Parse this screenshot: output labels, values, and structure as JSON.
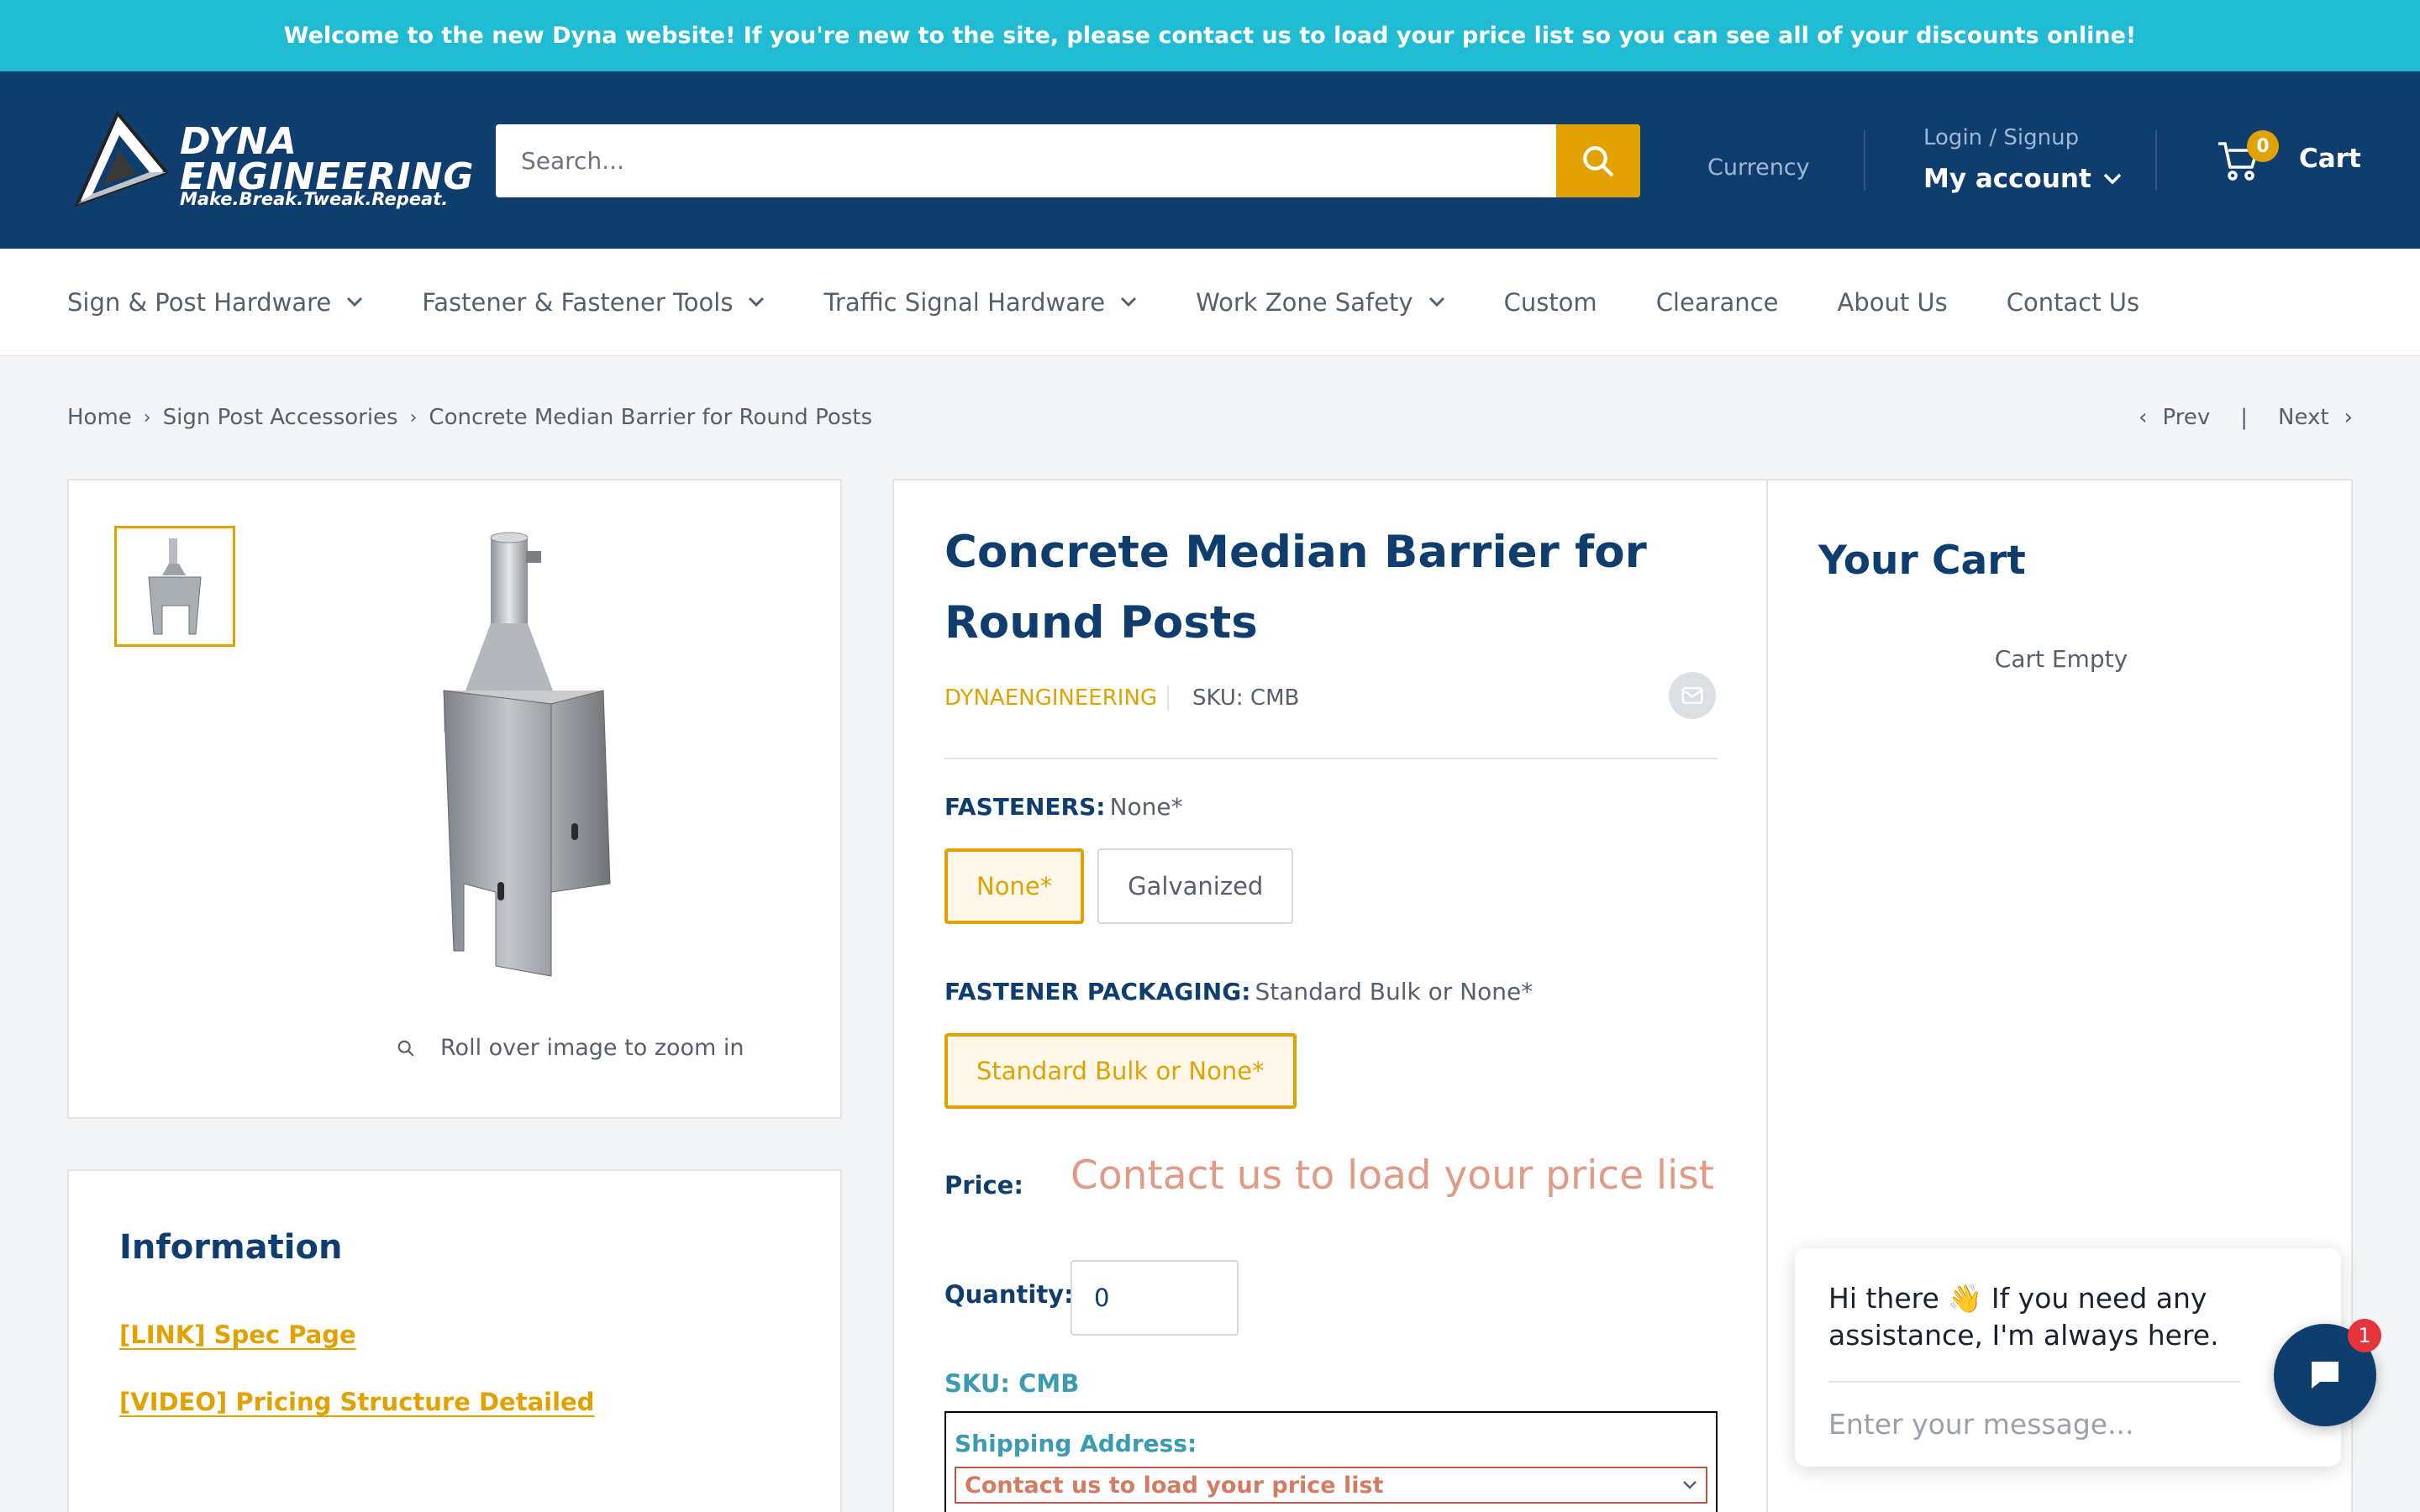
{
  "announcement": "Welcome to the new Dyna website! If you're new to the site, please contact us to load your price list so you can see all of your discounts online!",
  "header": {
    "logo_line1": "DYNA",
    "logo_line2": "ENGINEERING",
    "logo_tagline": "Make.Break.Tweak.Repeat.",
    "search_placeholder": "Search...",
    "currency": "Currency",
    "login": "Login / Signup",
    "my_account": "My account",
    "cart_count": "0",
    "cart_label": "Cart"
  },
  "nav": {
    "items": [
      {
        "label": "Sign & Post Hardware",
        "dropdown": true
      },
      {
        "label": "Fastener & Fastener Tools",
        "dropdown": true
      },
      {
        "label": "Traffic Signal Hardware",
        "dropdown": true
      },
      {
        "label": "Work Zone Safety",
        "dropdown": true
      },
      {
        "label": "Custom",
        "dropdown": false
      },
      {
        "label": "Clearance",
        "dropdown": false
      },
      {
        "label": "About Us",
        "dropdown": false
      },
      {
        "label": "Contact Us",
        "dropdown": false
      }
    ]
  },
  "breadcrumb": {
    "home": "Home",
    "category": "Sign Post Accessories",
    "current": "Concrete Median Barrier for Round Posts",
    "prev": "Prev",
    "separator": "|",
    "next": "Next"
  },
  "gallery": {
    "zoom_hint": "Roll over image to zoom in"
  },
  "information": {
    "title": "Information",
    "link1": "[LINK] Spec Page",
    "link2": "[VIDEO] Pricing Structure Detailed"
  },
  "product": {
    "title": "Concrete Median Barrier for Round Posts",
    "vendor": "DYNAENGINEERING",
    "sku": "SKU: CMB",
    "fasteners_label": "FASTENERS:",
    "fasteners_value": "None*",
    "fasteners_options": [
      "None*",
      "Galvanized"
    ],
    "packaging_label": "FASTENER PACKAGING:",
    "packaging_value": "Standard Bulk or None*",
    "packaging_options": [
      "Standard Bulk or None*"
    ],
    "price_label": "Price:",
    "price_value": "Contact us to load your price list",
    "quantity_label": "Quantity:",
    "quantity_value": "0",
    "sku_repeat": "SKU: CMB",
    "shipping_label": "Shipping Address:",
    "shipping_select": "Contact us to load your price list"
  },
  "cart_panel": {
    "title": "Your Cart",
    "empty": "Cart Empty"
  },
  "chat": {
    "message": "Hi there 👋 If you need any assistance, I'm always here.",
    "placeholder": "Enter your message...",
    "badge": "1"
  },
  "colors": {
    "announcement_bg": "#21bcd4",
    "header_bg": "#0f3e6e",
    "accent": "#e1a200",
    "price_text": "#e09a86"
  }
}
